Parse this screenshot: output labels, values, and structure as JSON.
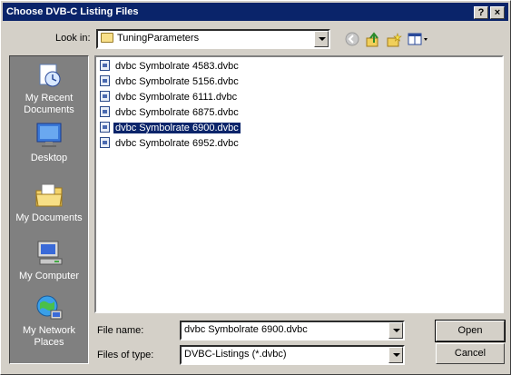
{
  "window": {
    "title": "Choose DVB-C Listing Files",
    "help_label": "?",
    "close_label": "×"
  },
  "toolbar": {
    "lookin_label": "Look in:",
    "lookin_value": "TuningParameters",
    "icons": [
      "back-icon",
      "up-folder-icon",
      "new-folder-icon",
      "view-menu-icon"
    ]
  },
  "places": [
    {
      "label": "My Recent Documents",
      "icon": "recent-documents-icon"
    },
    {
      "label": "Desktop",
      "icon": "desktop-icon"
    },
    {
      "label": "My Documents",
      "icon": "my-documents-icon"
    },
    {
      "label": "My Computer",
      "icon": "my-computer-icon"
    },
    {
      "label": "My Network Places",
      "icon": "network-places-icon"
    }
  ],
  "files": [
    {
      "name": "dvbc Symbolrate 4583.dvbc",
      "selected": false
    },
    {
      "name": "dvbc Symbolrate 5156.dvbc",
      "selected": false
    },
    {
      "name": "dvbc Symbolrate 6111.dvbc",
      "selected": false
    },
    {
      "name": "dvbc Symbolrate 6875.dvbc",
      "selected": false
    },
    {
      "name": "dvbc Symbolrate 6900.dvbc",
      "selected": true
    },
    {
      "name": "dvbc Symbolrate 6952.dvbc",
      "selected": false
    }
  ],
  "form": {
    "filename_label": "File name:",
    "filename_value": "dvbc Symbolrate 6900.dvbc",
    "filetype_label": "Files of type:",
    "filetype_value": "DVBC-Listings (*.dvbc)",
    "open_label": "Open",
    "cancel_label": "Cancel"
  },
  "colors": {
    "titlebar": "#0a246a",
    "selection": "#0a246a",
    "places_bg": "#808080",
    "dialog_bg": "#d4d0c8"
  }
}
